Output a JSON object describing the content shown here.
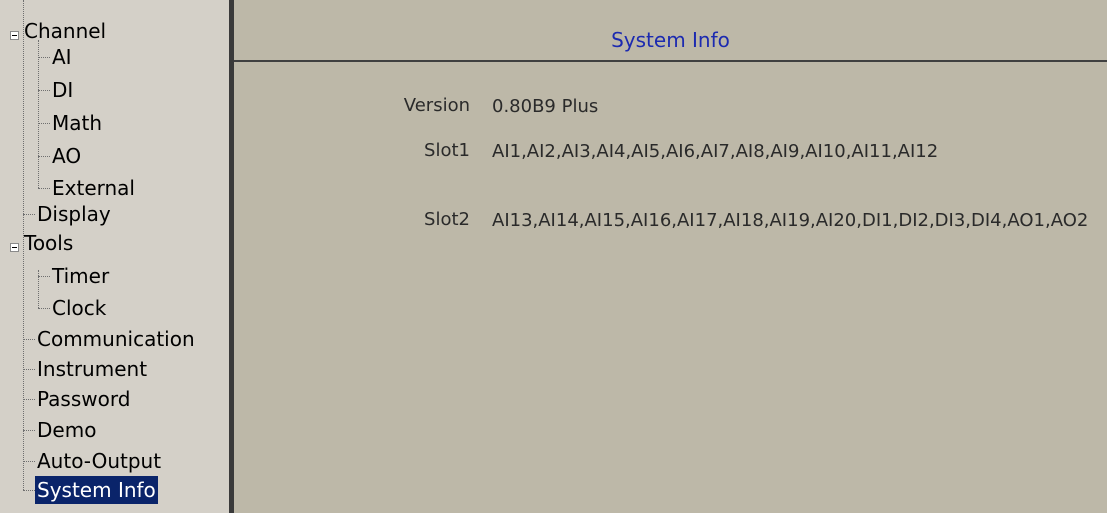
{
  "tree": {
    "items": [
      {
        "label": "Channel"
      },
      {
        "label": "AI"
      },
      {
        "label": "DI"
      },
      {
        "label": "Math"
      },
      {
        "label": "AO"
      },
      {
        "label": "External"
      },
      {
        "label": "Display"
      },
      {
        "label": "Tools"
      },
      {
        "label": "Timer"
      },
      {
        "label": "Clock"
      },
      {
        "label": "Communication"
      },
      {
        "label": "Instrument"
      },
      {
        "label": "Password"
      },
      {
        "label": "Demo"
      },
      {
        "label": "Auto-Output"
      },
      {
        "label": "System Info"
      }
    ],
    "selected": "System Info"
  },
  "main": {
    "title": "System Info",
    "rows": [
      {
        "label": "Version",
        "value": "0.80B9 Plus"
      },
      {
        "label": "Slot1",
        "value": "AI1,AI2,AI3,AI4,AI5,AI6,AI7,AI8,AI9,AI10,AI11,AI12"
      },
      {
        "label": "Slot2",
        "value": "AI13,AI14,AI15,AI16,AI17,AI18,AI19,AI20,DI1,DI2,DI3,DI4,AO1,AO2"
      }
    ]
  },
  "colors": {
    "sidebar_bg": "#d4d0c8",
    "main_bg": "#bdb8a8",
    "title_text": "#1c2ab0",
    "selection_bg": "#0a246a"
  }
}
